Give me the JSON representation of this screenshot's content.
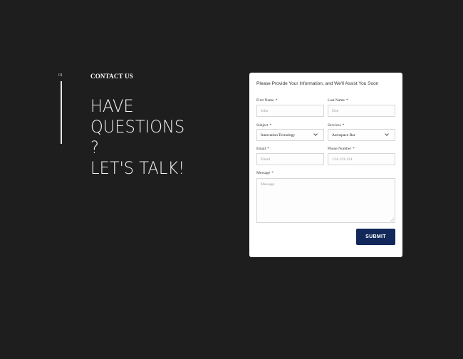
{
  "intro": {
    "step_number": "01",
    "eyebrow": "CONTACT US",
    "headline_lines": [
      "HAVE",
      "QUESTIONS",
      "?",
      "LET'S TALK!"
    ]
  },
  "form": {
    "title": "Please Provide Your Information, and We'll Assist You Soon",
    "first_name": {
      "label": "First Name",
      "required": "*",
      "placeholder": "John"
    },
    "last_name": {
      "label": "Last Name",
      "required": "*",
      "placeholder": "Doe"
    },
    "subject": {
      "label": "Subject",
      "required": "*",
      "value": "Innovation Tecnology"
    },
    "services": {
      "label": "Services",
      "required": "*",
      "value": "Aerospace Bar"
    },
    "email": {
      "label": "Email",
      "required": "*",
      "placeholder": "Email"
    },
    "phone": {
      "label": "Phone Number",
      "required": "*",
      "placeholder": "124-123-124"
    },
    "message": {
      "label": "Message",
      "required": "*",
      "placeholder": "Message"
    },
    "submit_label": "SUBMIT"
  },
  "colors": {
    "background": "#1e1e1e",
    "card": "#ffffff",
    "submit": "#12285a"
  }
}
